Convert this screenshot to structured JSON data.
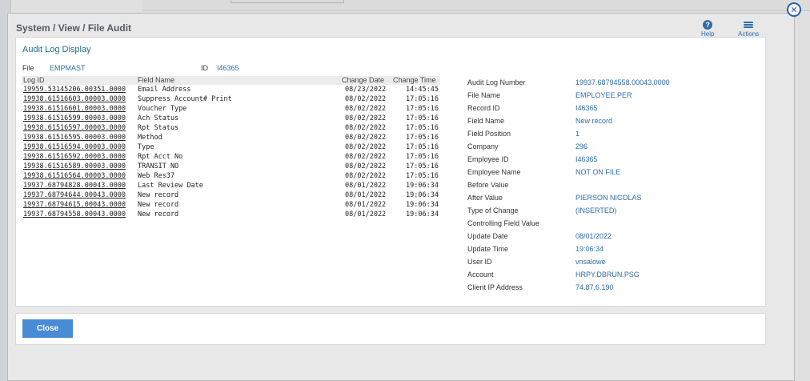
{
  "modal": {
    "title": "System / View / File Audit",
    "help_label": "Help",
    "actions_label": "Actions",
    "close_x": "✕"
  },
  "panel": {
    "title": "Audit Log Display",
    "file_label": "File",
    "file_value": "EMPMAST",
    "id_label": "ID",
    "id_value": "I46365"
  },
  "log_table": {
    "headers": [
      "Log ID",
      "Field Name",
      "Change Date",
      "Change Time"
    ],
    "rows": [
      {
        "log_id": "19959.53145206.00351.0000",
        "field": "Email Address",
        "date": "08/23/2022",
        "time": "14:45:45"
      },
      {
        "log_id": "19938.61516603.00003.0000",
        "field": "Suppress Account# Print",
        "date": "08/02/2022",
        "time": "17:05:16"
      },
      {
        "log_id": "19938.61516601.00003.0000",
        "field": "Voucher Type",
        "date": "08/02/2022",
        "time": "17:05:16"
      },
      {
        "log_id": "19938.61516599.00003.0000",
        "field": "Ach Status",
        "date": "08/02/2022",
        "time": "17:05:16"
      },
      {
        "log_id": "19938.61516597.00003.0000",
        "field": "Rpt Status",
        "date": "08/02/2022",
        "time": "17:05:16"
      },
      {
        "log_id": "19938.61516595.00003.0000",
        "field": "Method",
        "date": "08/02/2022",
        "time": "17:05:16"
      },
      {
        "log_id": "19938.61516594.00003.0000",
        "field": "Type",
        "date": "08/02/2022",
        "time": "17:05:16"
      },
      {
        "log_id": "19938.61516592.00003.0000",
        "field": "Rpt Acct No",
        "date": "08/02/2022",
        "time": "17:05:16"
      },
      {
        "log_id": "19938.61516589.00003.0000",
        "field": "TRANSIT NO",
        "date": "08/02/2022",
        "time": "17:05:16"
      },
      {
        "log_id": "19938.61516564.00003.0000",
        "field": "Web Res37",
        "date": "08/02/2022",
        "time": "17:05:16"
      },
      {
        "log_id": "19937.68794828.00043.0000",
        "field": "Last Review Date",
        "date": "08/01/2022",
        "time": "19:06:34"
      },
      {
        "log_id": "19937.68794644.00043.0000",
        "field": "New record",
        "date": "08/01/2022",
        "time": "19:06:34"
      },
      {
        "log_id": "19937.68794615.00043.0000",
        "field": "New record",
        "date": "08/01/2022",
        "time": "19:06:34"
      },
      {
        "log_id": "19937.68794558.00043.0000",
        "field": "New record",
        "date": "08/01/2022",
        "time": "19:06:34"
      }
    ]
  },
  "details": [
    {
      "label": "Audit Log Number",
      "value": "19937.68794558.00043.0000"
    },
    {
      "label": "File Name",
      "value": "EMPLOYEE.PER"
    },
    {
      "label": "Record ID",
      "value": "I46365"
    },
    {
      "label": "Field Name",
      "value": "New record"
    },
    {
      "label": "Field Position",
      "value": "1"
    },
    {
      "label": "Company",
      "value": "296"
    },
    {
      "label": "Employee ID",
      "value": "I46365"
    },
    {
      "label": "Employee Name",
      "value": "NOT ON FILE"
    },
    {
      "label": "Before Value",
      "value": ""
    },
    {
      "label": "After Value",
      "value": "PIERSON NICOLAS"
    },
    {
      "label": "Type of Change",
      "value": "(INSERTED)"
    },
    {
      "label": "Controlling Field Value",
      "value": ""
    },
    {
      "label": "Update Date",
      "value": "08/01/2022"
    },
    {
      "label": "Update Time",
      "value": "19:06:34"
    },
    {
      "label": "User ID",
      "value": "vnsalowe"
    },
    {
      "label": "Account",
      "value": "HRPY.DBRUN.PSG"
    },
    {
      "label": "Client IP Address",
      "value": "74.87.6.190"
    }
  ],
  "footer": {
    "close_label": "Close"
  },
  "colors": {
    "accent": "#2f6da8",
    "button": "#4a8bd6",
    "title_teal": "#1f6f8a"
  }
}
